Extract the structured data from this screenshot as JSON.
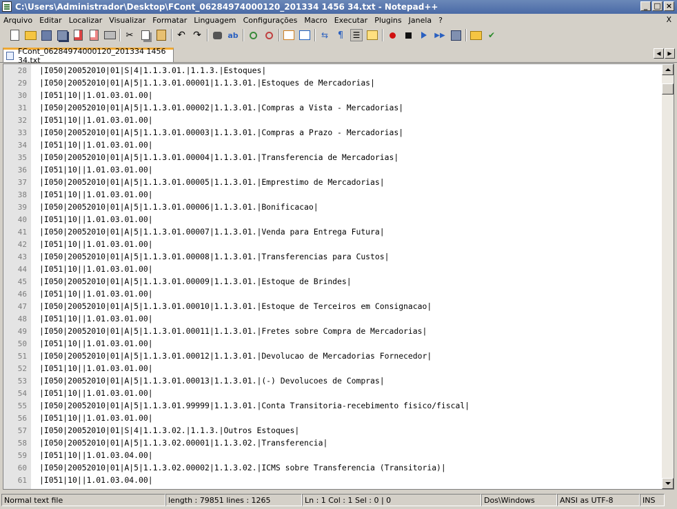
{
  "window": {
    "title": "C:\\Users\\Administrador\\Desktop\\FCont_06284974000120_201334 1456 34.txt - Notepad++"
  },
  "menu": {
    "items": [
      "Arquivo",
      "Editar",
      "Localizar",
      "Visualizar",
      "Formatar",
      "Linguagem",
      "Configurações",
      "Macro",
      "Executar",
      "Plugins",
      "Janela",
      "?"
    ],
    "close": "X"
  },
  "tab": {
    "label": "FCont_06284974000120_201334 1456 34.txt"
  },
  "editor": {
    "lines": [
      {
        "n": "28",
        "t": "|I050|20052010|01|S|4|1.1.3.01.|1.1.3.|Estoques|"
      },
      {
        "n": "29",
        "t": "|I050|20052010|01|A|5|1.1.3.01.00001|1.1.3.01.|Estoques de Mercadorias|"
      },
      {
        "n": "30",
        "t": "|I051|10||1.01.03.01.00|"
      },
      {
        "n": "31",
        "t": "|I050|20052010|01|A|5|1.1.3.01.00002|1.1.3.01.|Compras a Vista - Mercadorias|"
      },
      {
        "n": "32",
        "t": "|I051|10||1.01.03.01.00|"
      },
      {
        "n": "33",
        "t": "|I050|20052010|01|A|5|1.1.3.01.00003|1.1.3.01.|Compras a Prazo - Mercadorias|"
      },
      {
        "n": "34",
        "t": "|I051|10||1.01.03.01.00|"
      },
      {
        "n": "35",
        "t": "|I050|20052010|01|A|5|1.1.3.01.00004|1.1.3.01.|Transferencia de Mercadorias|"
      },
      {
        "n": "36",
        "t": "|I051|10||1.01.03.01.00|"
      },
      {
        "n": "37",
        "t": "|I050|20052010|01|A|5|1.1.3.01.00005|1.1.3.01.|Emprestimo de Mercadorias|"
      },
      {
        "n": "38",
        "t": "|I051|10||1.01.03.01.00|"
      },
      {
        "n": "39",
        "t": "|I050|20052010|01|A|5|1.1.3.01.00006|1.1.3.01.|Bonificacao|"
      },
      {
        "n": "40",
        "t": "|I051|10||1.01.03.01.00|"
      },
      {
        "n": "41",
        "t": "|I050|20052010|01|A|5|1.1.3.01.00007|1.1.3.01.|Venda para Entrega Futura|"
      },
      {
        "n": "42",
        "t": "|I051|10||1.01.03.01.00|"
      },
      {
        "n": "43",
        "t": "|I050|20052010|01|A|5|1.1.3.01.00008|1.1.3.01.|Transferencias para Custos|"
      },
      {
        "n": "44",
        "t": "|I051|10||1.01.03.01.00|"
      },
      {
        "n": "45",
        "t": "|I050|20052010|01|A|5|1.1.3.01.00009|1.1.3.01.|Estoque de Brindes|"
      },
      {
        "n": "46",
        "t": "|I051|10||1.01.03.01.00|"
      },
      {
        "n": "47",
        "t": "|I050|20052010|01|A|5|1.1.3.01.00010|1.1.3.01.|Estoque de Terceiros em Consignacao|"
      },
      {
        "n": "48",
        "t": "|I051|10||1.01.03.01.00|"
      },
      {
        "n": "49",
        "t": "|I050|20052010|01|A|5|1.1.3.01.00011|1.1.3.01.|Fretes sobre Compra de Mercadorias|"
      },
      {
        "n": "50",
        "t": "|I051|10||1.01.03.01.00|"
      },
      {
        "n": "51",
        "t": "|I050|20052010|01|A|5|1.1.3.01.00012|1.1.3.01.|Devolucao de Mercadorias Fornecedor|"
      },
      {
        "n": "52",
        "t": "|I051|10||1.01.03.01.00|"
      },
      {
        "n": "53",
        "t": "|I050|20052010|01|A|5|1.1.3.01.00013|1.1.3.01.|(-) Devolucoes de Compras|"
      },
      {
        "n": "54",
        "t": "|I051|10||1.01.03.01.00|"
      },
      {
        "n": "55",
        "t": "|I050|20052010|01|A|5|1.1.3.01.99999|1.1.3.01.|Conta Transitoria-recebimento fisico/fiscal|"
      },
      {
        "n": "56",
        "t": "|I051|10||1.01.03.01.00|"
      },
      {
        "n": "57",
        "t": "|I050|20052010|01|S|4|1.1.3.02.|1.1.3.|Outros Estoques|"
      },
      {
        "n": "58",
        "t": "|I050|20052010|01|A|5|1.1.3.02.00001|1.1.3.02.|Transferencia|"
      },
      {
        "n": "59",
        "t": "|I051|10||1.01.03.04.00|"
      },
      {
        "n": "60",
        "t": "|I050|20052010|01|A|5|1.1.3.02.00002|1.1.3.02.|ICMS sobre Transferencia (Transitoria)|"
      },
      {
        "n": "61",
        "t": "|I051|10||1.01.03.04.00|"
      }
    ]
  },
  "status": {
    "filetype": "Normal text file",
    "length": "length : 79851   lines : 1265",
    "position": "Ln : 1    Col : 1    Sel : 0 | 0",
    "eol": "Dos\\Windows",
    "encoding": "ANSI as UTF-8",
    "mode": "INS"
  },
  "toolbar": {
    "icons": [
      "new-file",
      "open-file",
      "save",
      "save-all",
      "close",
      "close-all",
      "print",
      "cut",
      "copy",
      "paste",
      "undo",
      "redo",
      "find",
      "replace",
      "zoom-in",
      "zoom-out",
      "sync-vertical",
      "sync-horizontal",
      "word-wrap",
      "show-all-chars",
      "indent-guide",
      "function-list",
      "record-macro",
      "stop-macro",
      "play-macro",
      "run-macro-multiple",
      "save-macro",
      "open-folder",
      "spell-check"
    ]
  }
}
